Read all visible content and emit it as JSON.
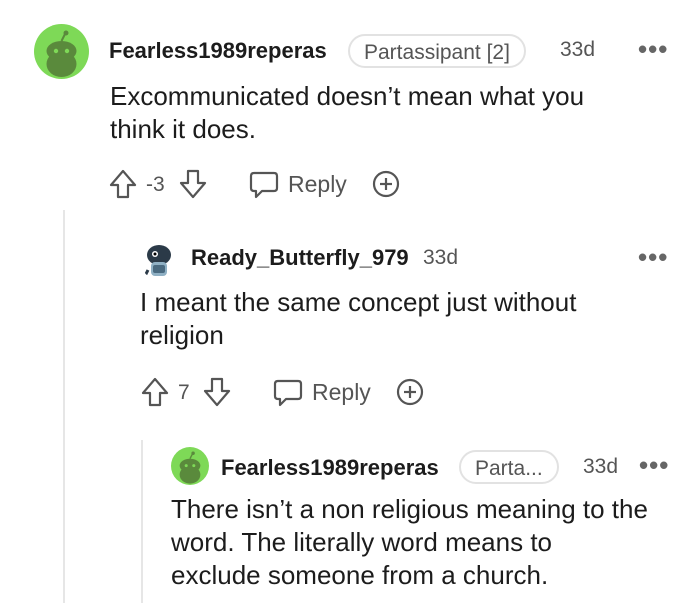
{
  "comments": [
    {
      "username": "Fearless1989reperas",
      "flair": "Partassipant [2]",
      "time": "33d",
      "body_lines": [
        "Excommunicated doesn’t mean what you",
        "think it does."
      ],
      "score": "-3",
      "reply_label": "Reply",
      "avatar": "snoo-avatar-green"
    },
    {
      "username": "Ready_Butterfly_979",
      "time": "33d",
      "body_lines": [
        "I meant the same concept just without",
        "religion"
      ],
      "score": "7",
      "reply_label": "Reply",
      "avatar": "custom-avatar"
    },
    {
      "username": "Fearless1989reperas",
      "flair": "Parta...",
      "time": "33d",
      "body_lines": [
        "There isn’t a non religious meaning to the",
        "word. The literally word means to",
        "exclude someone from a church."
      ],
      "avatar": "snoo-avatar-green"
    }
  ],
  "more_icon": "•••",
  "colors": {
    "avatar_green": "#7ed957",
    "text": "#1c1c1c",
    "muted": "#555555",
    "thread_line": "#e6e6e6"
  }
}
